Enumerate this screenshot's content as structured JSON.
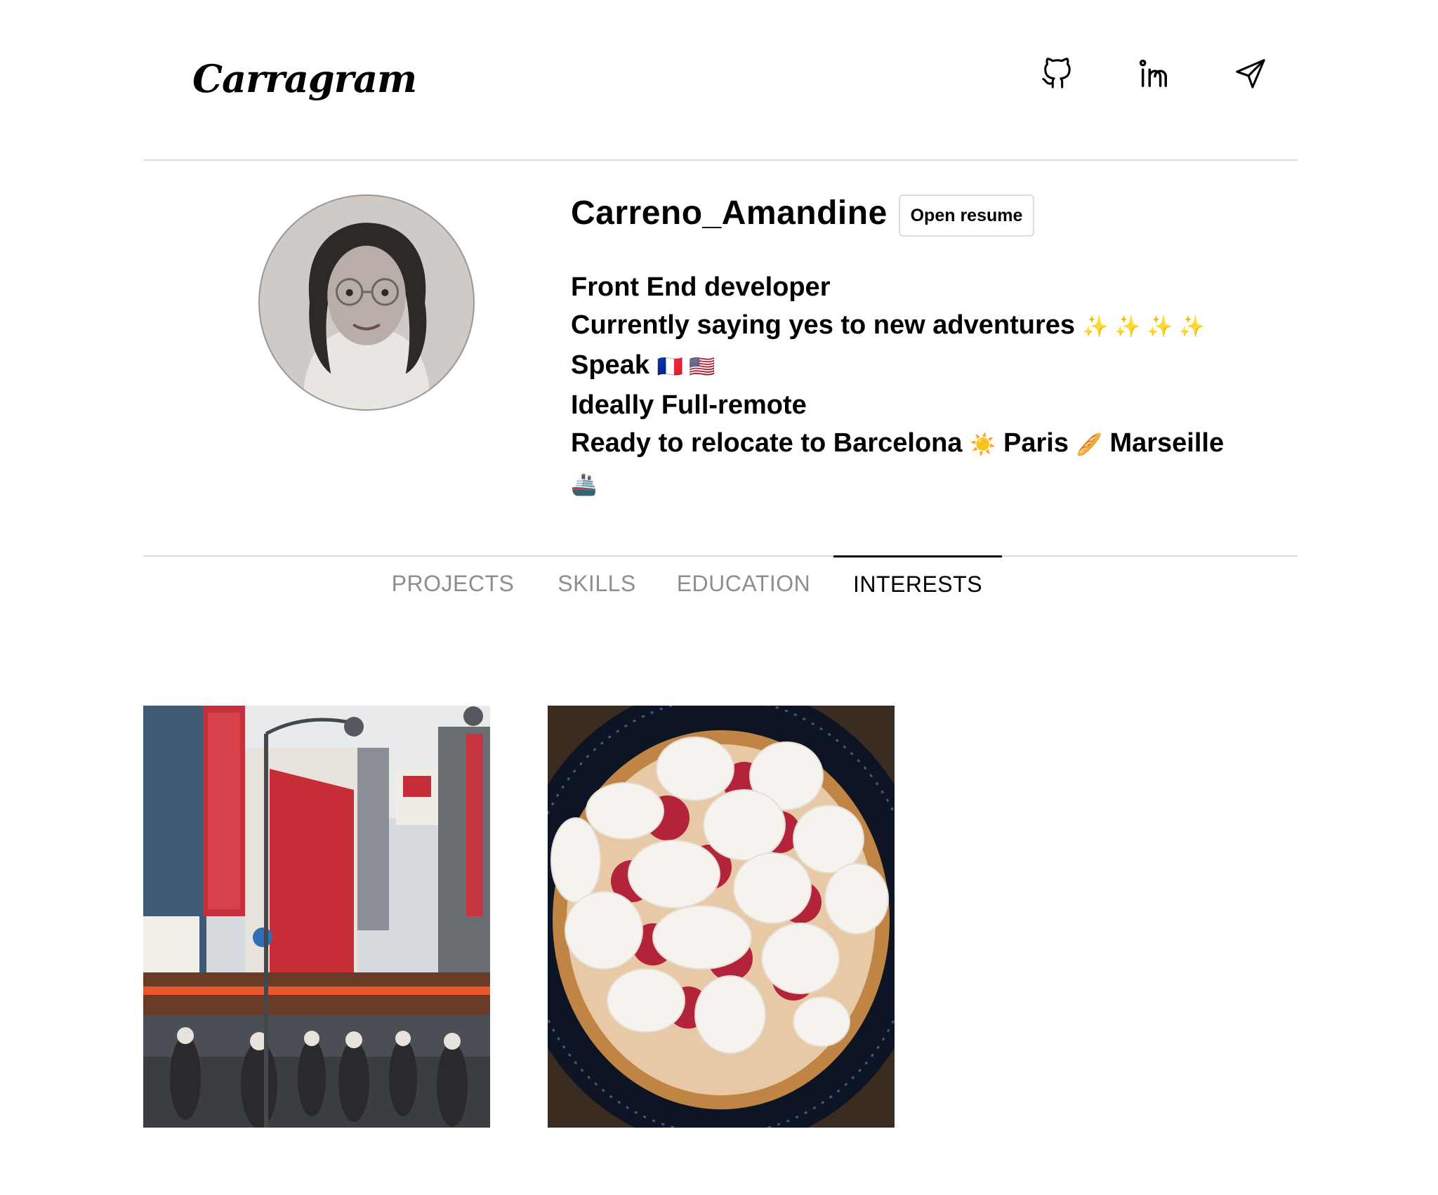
{
  "header": {
    "logo_text": "Carragram",
    "icons": [
      "github-icon",
      "linkedin-icon",
      "send-icon"
    ]
  },
  "profile": {
    "username": "Carreno_Amandine",
    "resume_button": "Open resume",
    "bio": {
      "line1": "Front End developer",
      "line2": "Currently saying yes to new adventures",
      "line2_emoji": "✨ ✨ ✨ ✨",
      "line3": "Speak",
      "line3_emoji": "🇫🇷 🇺🇸",
      "line4": "Ideally Full-remote",
      "line5_a": "Ready to relocate to Barcelona",
      "line5_emoji_a": "☀️",
      "line5_b": "Paris",
      "line5_emoji_b": "🥖",
      "line5_c": "Marseille",
      "line6_emoji": "🚢"
    }
  },
  "tabs": [
    {
      "label": "PROJECTS",
      "active": false
    },
    {
      "label": "SKILLS",
      "active": false
    },
    {
      "label": "EDUCATION",
      "active": false
    },
    {
      "label": "INTERESTS",
      "active": true
    }
  ],
  "colors": {
    "divider": "#dbdbdb",
    "tab_inactive": "#8e8e8e",
    "tab_active": "#000000"
  }
}
